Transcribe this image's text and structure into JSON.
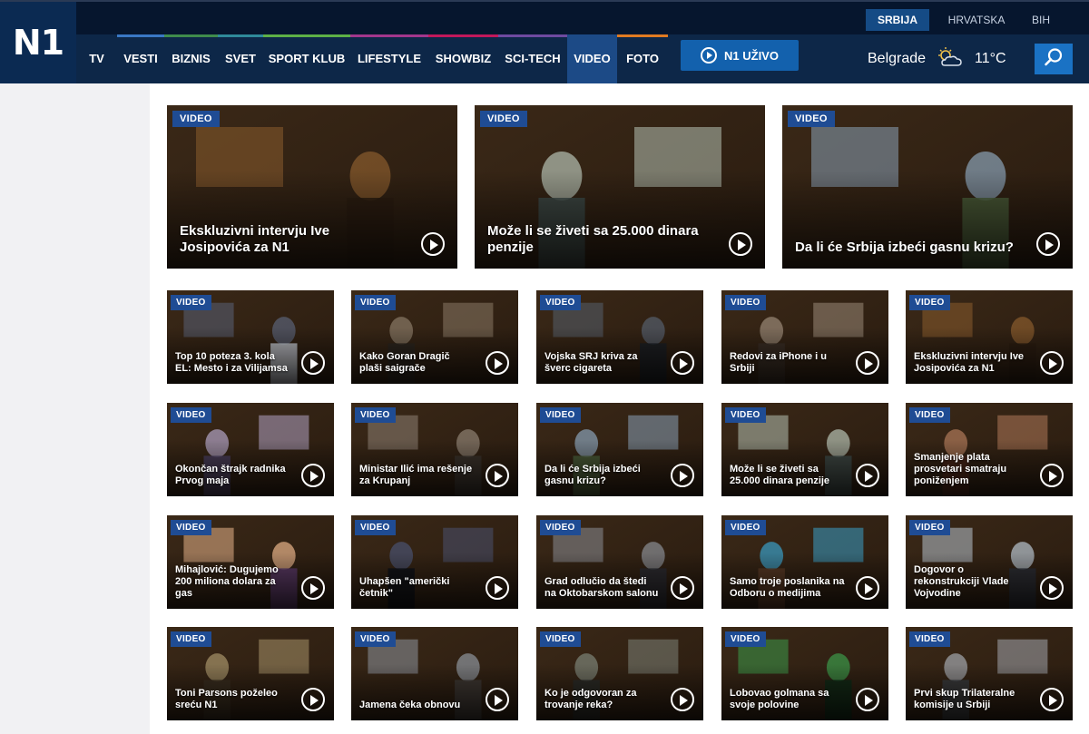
{
  "logo": "N1",
  "regions": [
    {
      "label": "SRBIJA",
      "active": true
    },
    {
      "label": "HRVATSKA",
      "active": false
    },
    {
      "label": "BIH",
      "active": false
    }
  ],
  "nav": [
    {
      "label": "TV",
      "color": "#0d2748",
      "active": false
    },
    {
      "label": "VESTI",
      "color": "#3a78c4",
      "active": false
    },
    {
      "label": "BIZNIS",
      "color": "#3f8c4c",
      "active": false
    },
    {
      "label": "SVET",
      "color": "#2f8a9a",
      "active": false
    },
    {
      "label": "SPORT KLUB",
      "color": "#5db046",
      "active": false
    },
    {
      "label": "LIFESTYLE",
      "color": "#a2378c",
      "active": false
    },
    {
      "label": "SHOWBIZ",
      "color": "#c2185b",
      "active": false
    },
    {
      "label": "SCI-TECH",
      "color": "#6e4aa0",
      "active": false
    },
    {
      "label": "VIDEO",
      "color": "#1c4a86",
      "active": true
    },
    {
      "label": "FOTO",
      "color": "#e07b22",
      "active": false
    }
  ],
  "live_button": {
    "label": "N1 UŽIVO",
    "icon": "play-circle-icon"
  },
  "weather": {
    "city": "Belgrade",
    "icon": "partly-cloudy-icon",
    "temperature": "11°C"
  },
  "search": {
    "icon": "search-icon"
  },
  "badge_label": "VIDEO",
  "featured": [
    {
      "title": "Ekskluzivni intervju Ive Josipovića za N1",
      "scene": [
        "#3a2817",
        "#8a5c2e",
        "#2a1c10"
      ]
    },
    {
      "title": "Može li se živeti sa 25.000 dinara penzije",
      "scene": [
        "#5a6e6a",
        "#b7c2b4",
        "#3d4a48"
      ]
    },
    {
      "title": "Da li će Srbija izbeći gasnu krizu?",
      "scene": [
        "#3f5a78",
        "#8aa3b8",
        "#4a5e3a"
      ]
    }
  ],
  "videos": [
    {
      "title": "Top 10 poteza 3. kola EL: Mesto i za Vilijamsa",
      "scene": [
        "#1b2230",
        "#5a6278",
        "#c0c4cc"
      ]
    },
    {
      "title": "Kako Goran Dragič plaši saigrače",
      "scene": [
        "#4a4138",
        "#8a7a66",
        "#2a241e"
      ]
    },
    {
      "title": "Vojska SRJ kriva za šverc cigareta",
      "scene": [
        "#2e3440",
        "#55606e",
        "#1a1e24"
      ]
    },
    {
      "title": "Redovi za iPhone i u Srbiji",
      "scene": [
        "#5a4a3e",
        "#9b8a78",
        "#3a2e26"
      ]
    },
    {
      "title": "Ekskluzivni intervju Ive Josipovića za N1",
      "scene": [
        "#3a2817",
        "#8a5c2e",
        "#2a1c10"
      ]
    },
    {
      "title": "Okončan štrajk radnika Prvog maja",
      "scene": [
        "#6e5a8a",
        "#b2a4c4",
        "#4a3e5e"
      ]
    },
    {
      "title": "Ministar Ilić ima rešenje za Krupanj",
      "scene": [
        "#5a5046",
        "#8e8274",
        "#3a342e"
      ]
    },
    {
      "title": "Da li će Srbija izbeći gasnu krizu?",
      "scene": [
        "#3f5a78",
        "#8aa3b8",
        "#4a5e3a"
      ]
    },
    {
      "title": "Može li se živeti sa 25.000 dinara penzije",
      "scene": [
        "#5a6e6a",
        "#b7c2b4",
        "#3d4a48"
      ]
    },
    {
      "title": "Smanjenje plata prosvetari smatraju poniženjem",
      "scene": [
        "#7a3a26",
        "#b07a5a",
        "#4a2418"
      ]
    },
    {
      "title": "Mihajlović: Dugujemo 200 miliona dolara za gas",
      "scene": [
        "#c04a2e",
        "#e8b48a",
        "#5a3a6a"
      ]
    },
    {
      "title": "Uhapšen \"američki četnik\"",
      "scene": [
        "#1c2030",
        "#4a5270",
        "#0e1018"
      ]
    },
    {
      "title": "Grad odlučio da štedi na Oktobarskom salonu",
      "scene": [
        "#4a4e56",
        "#8a8e96",
        "#2a2c32"
      ]
    },
    {
      "title": "Samo troje poslanika na Odboru o medijima",
      "scene": [
        "#8a5a3a",
        "#3aa0c8",
        "#5a3a24"
      ]
    },
    {
      "title": "Dogovor o rekonstrukciji Vlade Vojvodine",
      "scene": [
        "#6a7a8e",
        "#b8c4d0",
        "#2a2e36"
      ]
    },
    {
      "title": "Toni Parsons poželeo sreću N1",
      "scene": [
        "#6a5a3e",
        "#a8946a",
        "#3a2e20"
      ]
    },
    {
      "title": "Jamena čeka obnovu",
      "scene": [
        "#5a5e66",
        "#8e969e",
        "#3e3a36"
      ]
    },
    {
      "title": "Ko je odgovoran za trovanje reka?",
      "scene": [
        "#4a4e4a",
        "#7e8478",
        "#2a2c28"
      ]
    },
    {
      "title": "Lobovao golmana sa svoje polovine",
      "scene": [
        "#1e5a2e",
        "#3c9a4a",
        "#0e2a16"
      ]
    },
    {
      "title": "Prvi skup Trilateralne komisije u Srbiji",
      "scene": [
        "#6a6e74",
        "#a4a8ae",
        "#3a3c40"
      ]
    }
  ]
}
